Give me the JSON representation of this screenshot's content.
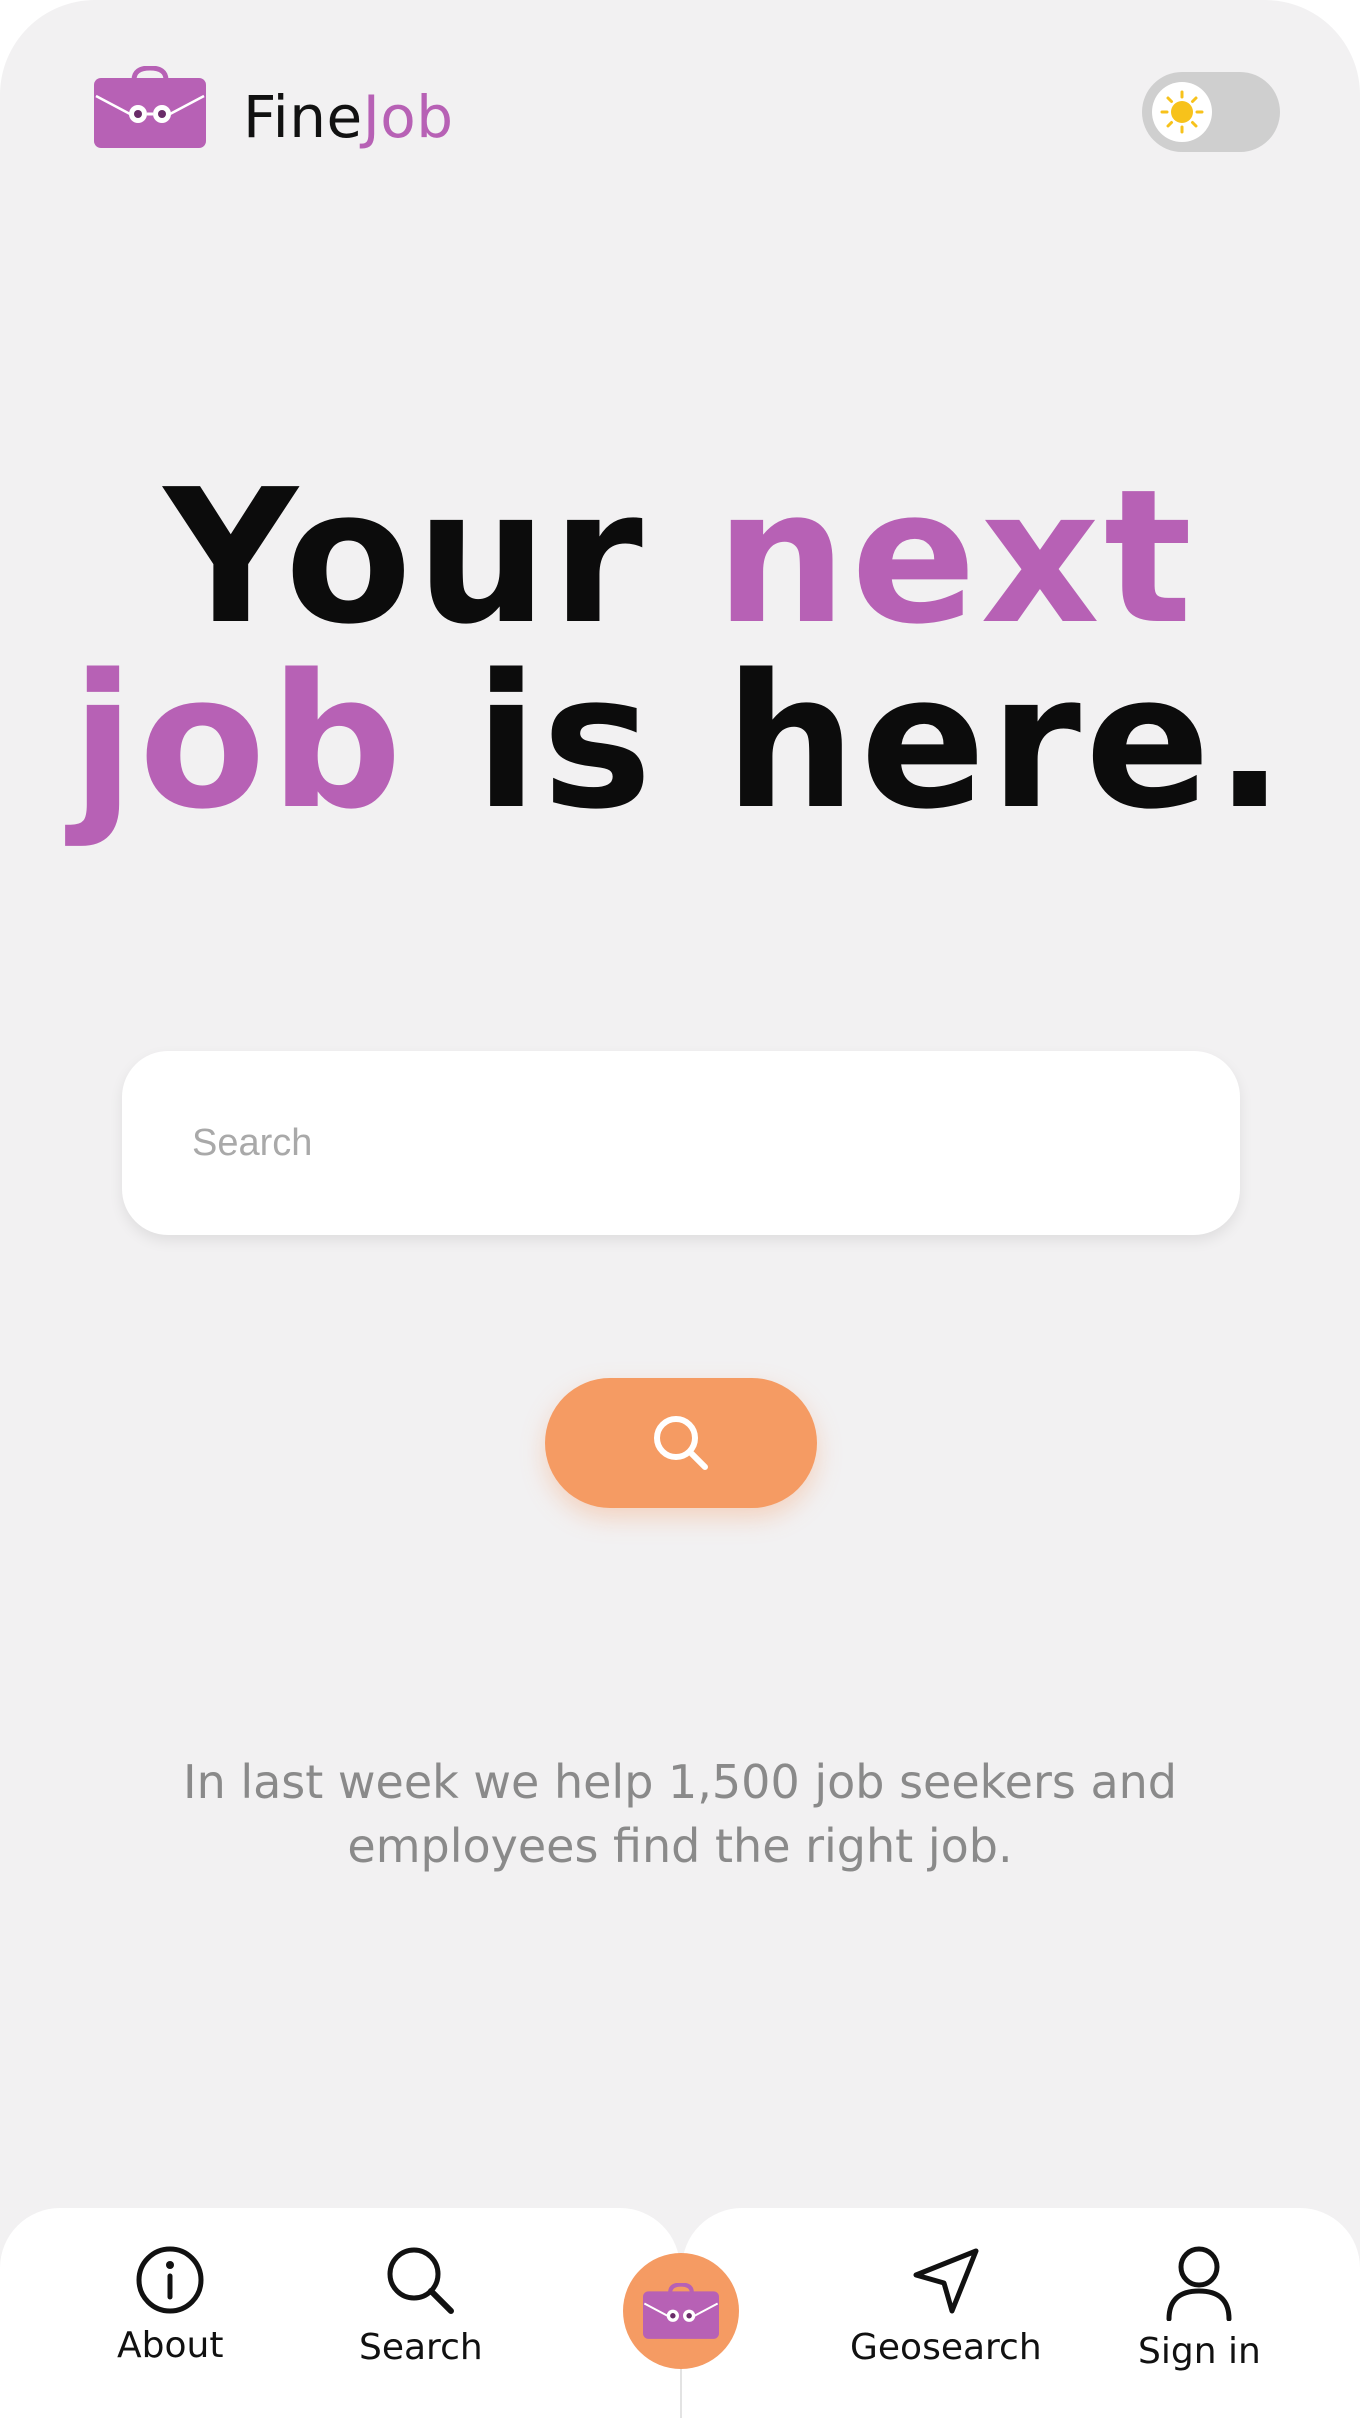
{
  "header": {
    "brand_part1": "Fine",
    "brand_part2": "Job",
    "logo_icon": "briefcase-eyes-icon",
    "theme_toggle_icon": "sun-icon"
  },
  "hero": {
    "line1_plain": "Your ",
    "line1_accent": "next",
    "line2_accent": "job",
    "line2_plain": " is here."
  },
  "search": {
    "placeholder": "Search",
    "value": "",
    "button_icon": "search-icon"
  },
  "tagline": "In last week we help 1,500 job seekers and employees find the right job.",
  "bottom_nav": {
    "items": [
      {
        "label": "About",
        "icon": "info-icon"
      },
      {
        "label": "Search",
        "icon": "search-icon"
      },
      {
        "label": "",
        "icon": "briefcase-eyes-icon"
      },
      {
        "label": "Geosearch",
        "icon": "location-arrow-icon"
      },
      {
        "label": "Sign in",
        "icon": "user-icon"
      }
    ]
  },
  "colors": {
    "accent": "#b761b5",
    "button": "#f59b63",
    "background": "#f2f1f2",
    "sun": "#f7c21b"
  }
}
